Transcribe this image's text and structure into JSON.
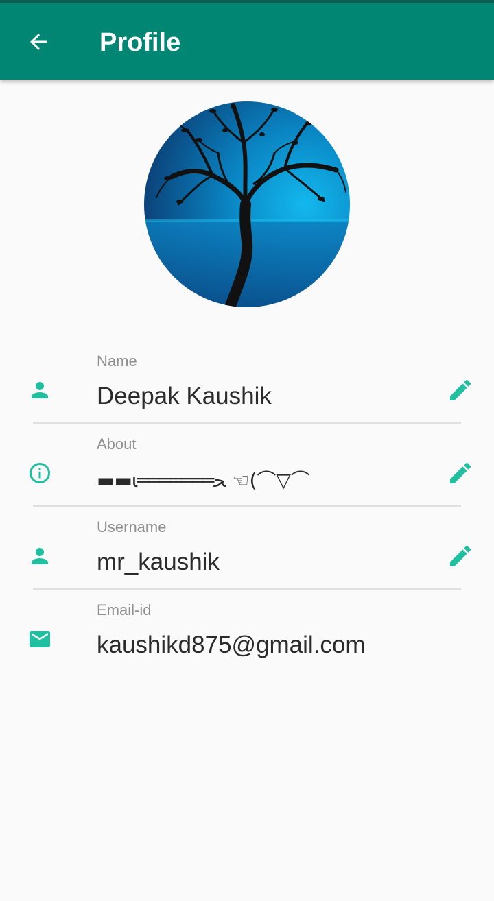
{
  "app_bar": {
    "title": "Profile",
    "back_icon": "arrow-left-icon"
  },
  "colors": {
    "app_bar": "#008673",
    "accent": "#1fbf9f",
    "background": "#fafafa"
  },
  "profile_photo": {
    "description_icon": "tree-silhouette-avatar"
  },
  "fields": {
    "name": {
      "label": "Name",
      "value": "Deepak Kaushik",
      "icon": "person-icon",
      "editable": true
    },
    "about": {
      "label": "About",
      "value": "▬▬ι═══════ﺤ  ☜(⌒▽⌒",
      "icon": "info-icon",
      "editable": true
    },
    "username": {
      "label": "Username",
      "value": "mr_kaushik",
      "icon": "person-icon",
      "editable": true
    },
    "email": {
      "label": "Email-id",
      "value": "kaushikd875@gmail.com",
      "icon": "mail-icon",
      "editable": false
    }
  }
}
